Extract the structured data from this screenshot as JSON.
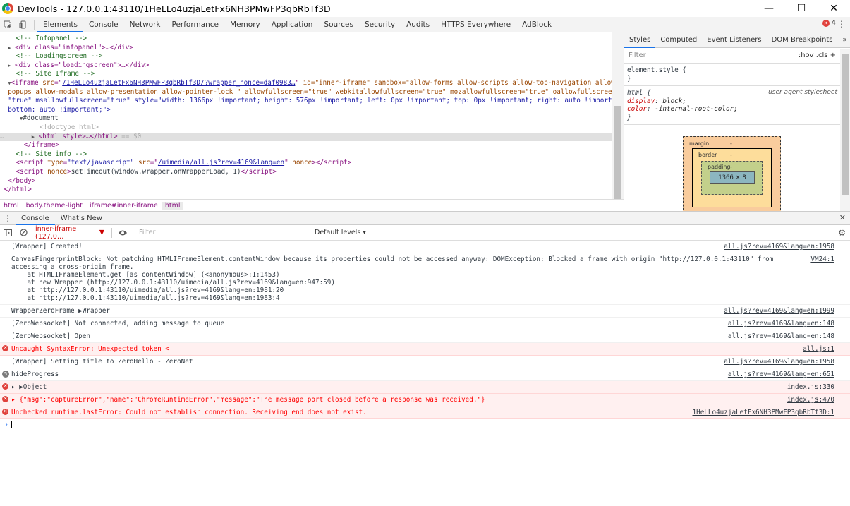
{
  "window": {
    "title": "DevTools - 127.0.0.1:43110/1HeLLo4uzjaLetFx6NH3PMwFP3qbRbTf3D",
    "minimize": "—",
    "maximize": "☐",
    "close": "✕"
  },
  "toolbar": {
    "tabs": [
      "Elements",
      "Console",
      "Network",
      "Performance",
      "Memory",
      "Application",
      "Sources",
      "Security",
      "Audits",
      "HTTPS Everywhere",
      "AdBlock"
    ],
    "active_tab": "Elements",
    "error_count": "4"
  },
  "dom": {
    "l1": "<!-- Infopanel -->",
    "l2_tag": "<div class=\"infopanel\">…</div>",
    "l3": "<!-- Loadingscreen -->",
    "l4_tag": "<div class=\"loadingscreen\">…</div>",
    "l5": "<!-- Site Iframe -->",
    "iframe_src": "/1HeLLo4uzjaLetFx6NH3PMwFP3qbRbTf3D/?wrapper_nonce=daf0983…",
    "iframe_rest1": "id=\"inner-iframe\" sandbox=\"allow-forms allow-scripts allow-top-navigation allow-",
    "iframe_rest2": "popups allow-modals allow-presentation allow-pointer-lock \" allowfullscreen=\"true\" webkitallowfullscreen=\"true\" mozallowfullscreen=\"true\" oallowfullscreen=",
    "iframe_rest3": "\"true\" msallowfullscreen=\"true\" style=\"width: 1366px !important; height: 576px !important; left: 0px !important; top: 0px !important; right: auto !important;",
    "iframe_rest4": "bottom: auto !important;\">",
    "document": "#document",
    "doctype": "<!doctype html>",
    "html_line": "<html style>…</html>",
    "html_suffix": " == $0",
    "iframe_close": "</iframe>",
    "site_info": "<!-- Site info -->",
    "script1_src": "/uimedia/all.js?rev=4169&lang=en",
    "script2_text": "setTimeout(window.wrapper.onWrapperLoad, 1)",
    "body_close": "</body>",
    "html_close": "</html>"
  },
  "breadcrumbs": [
    "html",
    "body.theme-light",
    "iframe#inner-iframe",
    "html"
  ],
  "styles": {
    "tabs": [
      "Styles",
      "Computed",
      "Event Listeners",
      "DOM Breakpoints",
      "»"
    ],
    "filter_placeholder": "Filter",
    "filter_tools": ":hov  .cls  +",
    "element_style": "element.style {",
    "close_brace": "}",
    "html_selector": "html {",
    "ua_label": "user agent stylesheet",
    "prop1": "display",
    "val1": "block;",
    "prop2": "color",
    "val2": "-internal-root-color;",
    "bm_margin": "margin",
    "bm_border": "border",
    "bm_padding": "padding",
    "bm_dash": "-",
    "bm_content": "1366 × 8"
  },
  "drawer": {
    "tabs": [
      "Console",
      "What's New"
    ],
    "close": "✕"
  },
  "console_toolbar": {
    "context": "inner-iframe (127.0…",
    "filter_placeholder": "Filter",
    "levels": "Default levels ▾"
  },
  "messages": [
    {
      "type": "log",
      "text": "[Wrapper] Created!",
      "loc": "all.js?rev=4169&lang=en:1958"
    },
    {
      "type": "log",
      "text": "CanvasFingerprintBlock: Not patching HTMLIFrameElement.contentWindow because its properties could not be accessed anyway: DOMException: Blocked a frame with origin \"http://127.0.0.1:43110\" from accessing a cross-origin frame.",
      "loc": "VM24:1",
      "stack": [
        "at HTMLIFrameElement.get [as contentWindow] (<anonymous>:1:1453)",
        "at new Wrapper (http://127.0.0.1:43110/uimedia/all.js?rev=4169&lang=en:947:59)",
        "at http://127.0.0.1:43110/uimedia/all.js?rev=4169&lang=en:1981:20",
        "at http://127.0.0.1:43110/uimedia/all.js?rev=4169&lang=en:1983:4"
      ]
    },
    {
      "type": "log",
      "text": "WrapperZeroFrame ▶Wrapper",
      "loc": "all.js?rev=4169&lang=en:1999"
    },
    {
      "type": "log",
      "text": "[ZeroWebsocket] Not connected, adding message to queue",
      "loc": "all.js?rev=4169&lang=en:148"
    },
    {
      "type": "log",
      "text": "[ZeroWebsocket] Open",
      "loc": "all.js?rev=4169&lang=en:148"
    },
    {
      "type": "error",
      "text": "Uncaught SyntaxError: Unexpected token <",
      "loc": "all.js:1"
    },
    {
      "type": "log",
      "text": "[Wrapper] Setting title to ZeroHello - ZeroNet",
      "loc": "all.js?rev=4169&lang=en:1958"
    },
    {
      "type": "count",
      "count": "5",
      "text": "hideProgress",
      "loc": "all.js?rev=4169&lang=en:651"
    },
    {
      "type": "error",
      "text": "▸ ▶Object",
      "loc": "index.js:330"
    },
    {
      "type": "error",
      "text": "▸ {\"msg\":\"captureError\",\"name\":\"ChromeRuntimeError\",\"message\":\"The message port closed before a response was received.\"}",
      "loc": "index.js:470"
    },
    {
      "type": "error",
      "text": "Unchecked runtime.lastError: Could not establish connection. Receiving end does not exist.",
      "loc": "1HeLLo4uzjaLetFx6NH3PMwFP3qbRbTf3D:1"
    }
  ],
  "prompt": "›"
}
